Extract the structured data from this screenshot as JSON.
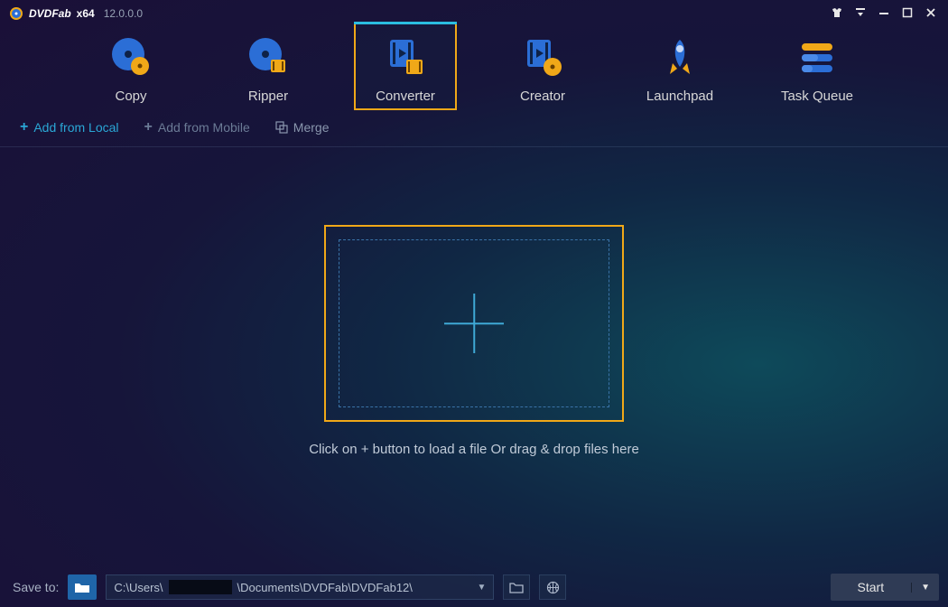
{
  "titlebar": {
    "app_name": "DVDFab",
    "arch": "x64",
    "version": "12.0.0.0"
  },
  "nav": {
    "items": [
      {
        "label": "Copy",
        "active": false
      },
      {
        "label": "Ripper",
        "active": false
      },
      {
        "label": "Converter",
        "active": true
      },
      {
        "label": "Creator",
        "active": false
      },
      {
        "label": "Launchpad",
        "active": false
      },
      {
        "label": "Task Queue",
        "active": false
      }
    ]
  },
  "toolbar": {
    "add_local": "Add from Local",
    "add_mobile": "Add from Mobile",
    "merge": "Merge"
  },
  "dropzone": {
    "hint": "Click on + button to load a file Or drag & drop files here"
  },
  "bottom": {
    "save_to_label": "Save to:",
    "path_prefix": "C:\\Users\\",
    "path_suffix": "\\Documents\\DVDFab\\DVDFab12\\",
    "start_label": "Start"
  }
}
